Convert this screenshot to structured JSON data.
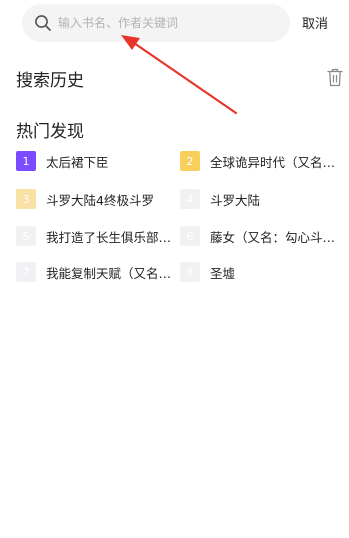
{
  "search": {
    "placeholder": "输入书名、作者关键词",
    "cancel_label": "取消"
  },
  "history": {
    "title": "搜索历史",
    "clear_icon": "trash-icon"
  },
  "hot": {
    "title": "热门发现",
    "items": [
      {
        "rank": "1",
        "title": "太后裙下臣",
        "badge_color": "#7b4bff"
      },
      {
        "rank": "2",
        "title": "全球诡异时代（又名…",
        "badge_color": "#f7cf5a"
      },
      {
        "rank": "3",
        "title": "斗罗大陆4终极斗罗",
        "badge_color": "#f9e1a6"
      },
      {
        "rank": "4",
        "title": "斗罗大陆",
        "badge_color": "#f1f1f3"
      },
      {
        "rank": "5",
        "title": "我打造了长生俱乐部…",
        "badge_color": "#f1f1f3"
      },
      {
        "rank": "6",
        "title": "藤女（又名：勾心斗…",
        "badge_color": "#f1f1f3"
      },
      {
        "rank": "7",
        "title": "我能复制天赋（又名…",
        "badge_color": "#f1f1f3"
      },
      {
        "rank": "8",
        "title": "圣墟",
        "badge_color": "#f1f1f3"
      }
    ]
  },
  "colors": {
    "annotation_arrow": "#e8342a",
    "search_bg": "#f4f4f5"
  }
}
